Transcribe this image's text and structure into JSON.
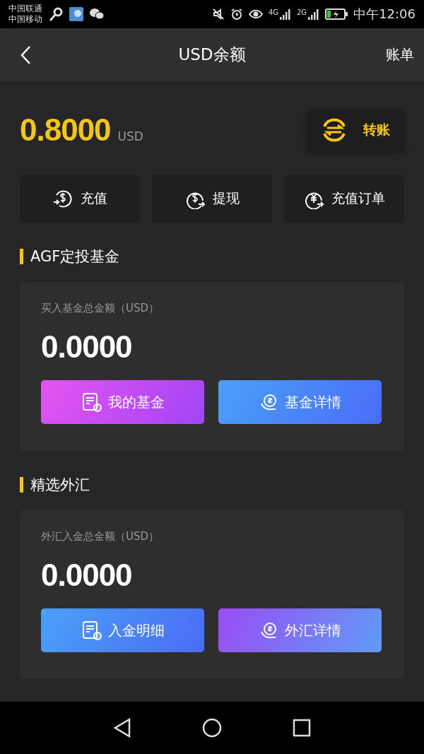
{
  "status_bar": {
    "carriers": [
      "中国联通",
      "中国移动"
    ],
    "signals": [
      "4G",
      "2G"
    ],
    "time": "中午12:06"
  },
  "nav": {
    "title": "USD余额",
    "action": "账单"
  },
  "balance": {
    "amount": "0.8000",
    "currency": "USD",
    "transfer": "转账"
  },
  "actions": [
    {
      "label": "充值"
    },
    {
      "label": "提现"
    },
    {
      "label": "充值订单"
    }
  ],
  "sections": [
    {
      "title": "AGF定投基金",
      "caption": "买入基金总金额（USD）",
      "amount": "0.0000",
      "buttons": [
        {
          "label": "我的基金",
          "kind": "magenta"
        },
        {
          "label": "基金详情",
          "kind": "blue"
        }
      ]
    },
    {
      "title": "精选外汇",
      "caption": "外汇入金总金额（USD）",
      "amount": "0.0000",
      "buttons": [
        {
          "label": "入金明细",
          "kind": "blue"
        },
        {
          "label": "外汇详情",
          "kind": "violet"
        }
      ]
    }
  ]
}
